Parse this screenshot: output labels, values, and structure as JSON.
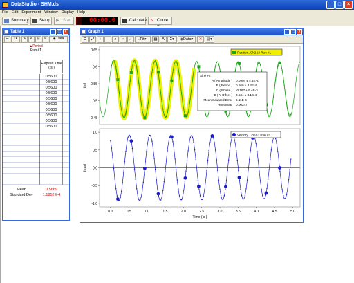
{
  "app": {
    "title": "DataStudio - SHM.ds"
  },
  "menu": [
    "File",
    "Edit",
    "Experiment",
    "Window",
    "Display",
    "Help"
  ],
  "toolbar": {
    "summary": "Summary",
    "setup": "Setup",
    "start": "Start",
    "timer": "00:00.0",
    "calculate": "Calculate",
    "curve_fit": "Curve Fit"
  },
  "table": {
    "title": "Table 1",
    "data_btn": "Data",
    "sensor": "Period",
    "run": "Run #1",
    "col_header": "Elapsed Time",
    "col_unit": "( s )",
    "values": [
      "0.5600",
      "0.5600",
      "0.5600",
      "0.5600",
      "0.5600",
      "0.5600",
      "0.5600",
      "0.5600",
      "0.5600",
      "0.5600"
    ],
    "mean_label": "Mean",
    "mean_value": "0.5669",
    "std_label": "Standard Dev",
    "std_value": "1.1952E-4"
  },
  "graph": {
    "title": "Graph 1",
    "fit_btn": "Fit",
    "data_btn": "Data",
    "top_legend": "Position, Ch2&3 Run #1",
    "bottom_legend": "Velocity, Ch2&3 Run #1",
    "top_ylabel": "(m)",
    "bottom_ylabel": "(m/s)",
    "xlabel": "Time ( s )",
    "fit": {
      "title": "Sine Fit",
      "rows": [
        [
          "A ( Amplitude )",
          "0.0904 ± 4.4E-4"
        ],
        [
          "B ( Period )",
          "0.569 ± 3.4E-4"
        ],
        [
          "C ( Phase )",
          "-0.167 ± 9.4E-3"
        ],
        [
          "D ( Y Offset )",
          "0.534 ± 3.1E-4"
        ],
        [
          "Mean Squared Error",
          "6.11E-6"
        ],
        [
          "Root MSE",
          "0.00247"
        ]
      ]
    }
  },
  "colors": {
    "position": "#1ea51e",
    "velocity": "#1c1cc8",
    "highlight": "#f0f000",
    "timer": "#dd0000"
  },
  "chart_data": [
    {
      "type": "line",
      "title": "",
      "series": [
        {
          "name": "Position, Ch2&3 Run #1",
          "period": 0.569,
          "amplitude": 0.0904,
          "offset": 0.534
        }
      ],
      "xlabel": "Time ( s )",
      "ylabel": "(m)",
      "xlim": [
        -0.3,
        5.2
      ],
      "ylim": [
        0.43,
        0.66
      ],
      "yticks": [
        0.45,
        0.5,
        0.55,
        0.6,
        0.65
      ]
    },
    {
      "type": "line",
      "title": "",
      "series": [
        {
          "name": "Velocity, Ch2&3 Run #1",
          "period": 0.569,
          "amplitude": 1.0
        }
      ],
      "xlabel": "Time ( s )",
      "ylabel": "(m/s)",
      "xlim": [
        -0.3,
        5.2
      ],
      "ylim": [
        -1.1,
        1.1
      ],
      "yticks": [
        -1.0,
        -0.5,
        0.0,
        0.5,
        1.0
      ],
      "xticks": [
        0.0,
        0.5,
        1.0,
        1.5,
        2.0,
        2.5,
        3.0,
        3.5,
        4.0,
        4.5,
        5.0
      ]
    }
  ]
}
